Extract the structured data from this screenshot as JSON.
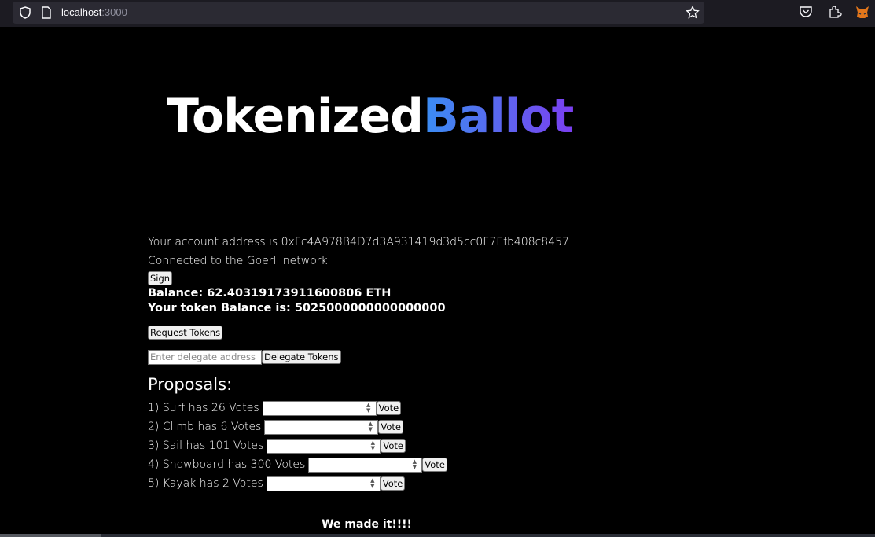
{
  "browser": {
    "url_host": "localhost",
    "url_port": ":3000"
  },
  "page": {
    "title_part1": "Tokenized",
    "title_part2": "Ballot",
    "account_line": "Your account address is 0xFc4A978B4D7d3A931419d3d5cc0F7Efb408c8457",
    "network_line": "Connected to the Goerli network",
    "sign_label": "Sign",
    "balance_line": "Balance: 62.40319173911600806 ETH",
    "token_balance_line": "Your token Balance is: 5025000000000000000",
    "request_tokens_label": "Request Tokens",
    "delegate_placeholder": "Enter delegate address",
    "delegate_label": "Delegate Tokens",
    "proposals_heading": "Proposals:",
    "proposals": [
      {
        "text": "1) Surf has 26 Votes",
        "vote_label": "Vote"
      },
      {
        "text": "2) Climb has 6 Votes",
        "vote_label": "Vote"
      },
      {
        "text": "3) Sail has 101 Votes",
        "vote_label": "Vote"
      },
      {
        "text": "4) Snowboard has 300 Votes",
        "vote_label": "Vote"
      },
      {
        "text": "5) Kayak has 2 Votes",
        "vote_label": "Vote"
      }
    ],
    "footer": "We made it!!!!"
  },
  "colors": {
    "background": "#000000",
    "title_gradient_start": "#3a8df2",
    "title_gradient_end": "#7b3ff0"
  }
}
